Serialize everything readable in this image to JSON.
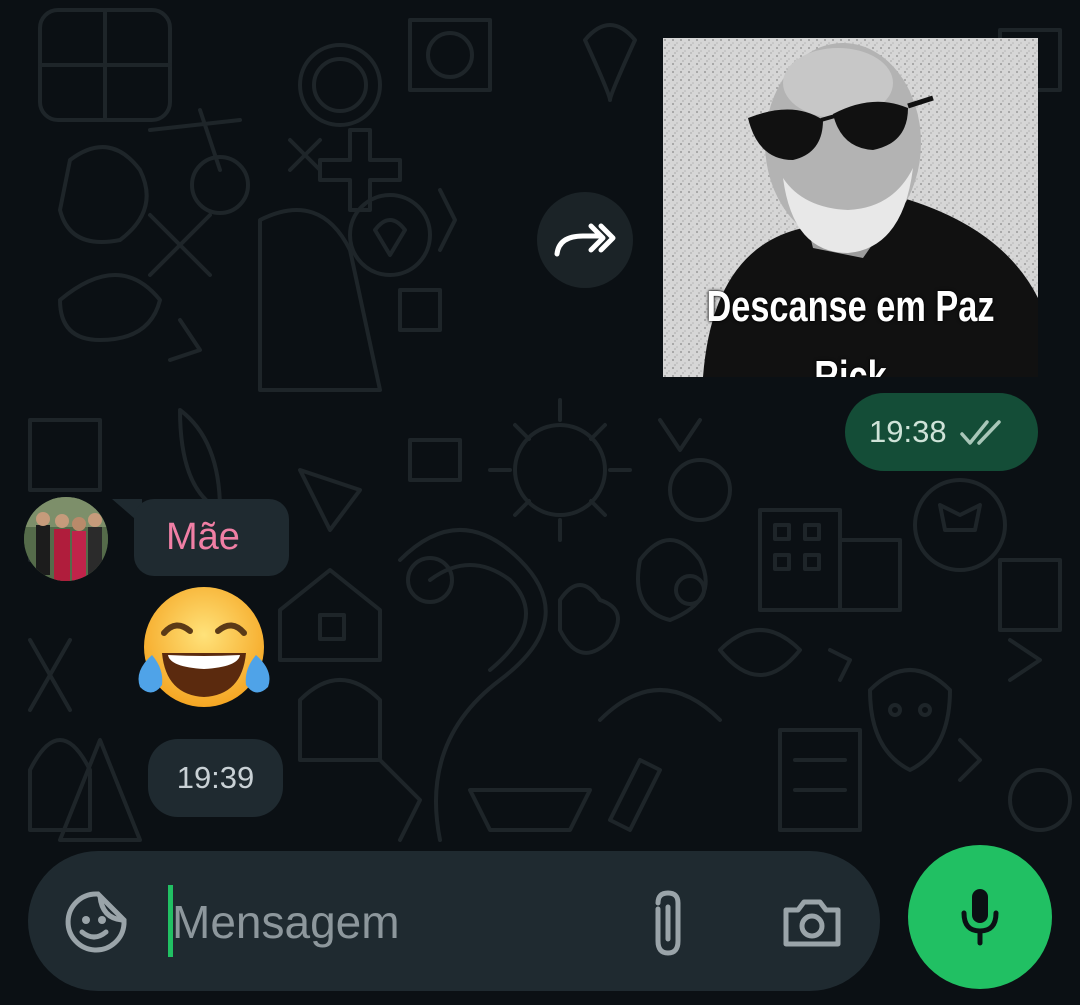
{
  "conversation": {
    "outgoing_sticker": {
      "caption_line1": "Descanse em Paz",
      "caption_line2": "Rick",
      "time": "19:38",
      "status_icon": "double-check-icon"
    },
    "incoming": {
      "sender_name": "Mãe",
      "emoji": "😂",
      "emoji_name": "face-with-tears-of-joy",
      "time": "19:39"
    }
  },
  "composer": {
    "placeholder": "Mensagem",
    "value": "",
    "icons": {
      "sticker": "sticker-icon",
      "attach": "paperclip-icon",
      "camera": "camera-icon",
      "mic": "microphone-icon"
    }
  },
  "colors": {
    "background": "#0b1014",
    "outgoing_bubble": "#144d37",
    "incoming_bubble": "#1f2a30",
    "accent": "#21c063",
    "sender_name": "#f07fa5"
  }
}
